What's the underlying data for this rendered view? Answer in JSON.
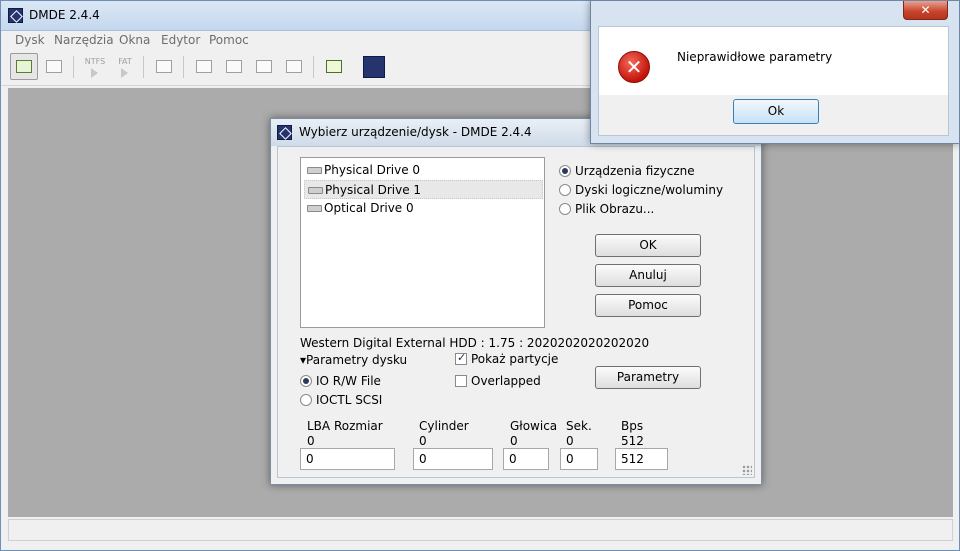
{
  "main_window": {
    "title": "DMDE 2.4.4",
    "menu": [
      "Dysk",
      "Narzędzia",
      "Okna",
      "Edytor",
      "Pomoc"
    ],
    "toolbar": {
      "ntfs_label": "NTFS",
      "fat_label": "FAT"
    }
  },
  "select_dialog": {
    "title": "Wybierz urządzenie/dysk - DMDE 2.4.4",
    "drives": [
      "Physical Drive 0",
      "Physical Drive 1",
      "Optical Drive 0"
    ],
    "selected_drive": "Physical Drive 1",
    "source_options": [
      "Urządzenia fizyczne",
      "Dyski logiczne/woluminy",
      "Plik Obrazu..."
    ],
    "selected_source": "Urządzenia fizyczne",
    "buttons": {
      "ok": "OK",
      "cancel": "Anuluj",
      "help": "Pomoc",
      "params": "Parametry"
    },
    "device_info": "Western Digital  External HDD    : 1.75 : 2020202020202020",
    "params_section": "Parametry dysku",
    "io_options": [
      "IO R/W File",
      "IOCTL SCSI"
    ],
    "selected_io": "IO R/W File",
    "checkboxes": {
      "show_partitions": {
        "label": "Pokaż partycje",
        "checked": true
      },
      "overlapped": {
        "label": "Overlapped",
        "checked": false
      }
    },
    "geometry": {
      "lba": {
        "label": "LBA Rozmiar",
        "current": "0",
        "value": "0"
      },
      "cylinder": {
        "label": "Cylinder",
        "current": "0",
        "value": "0"
      },
      "heads": {
        "label": "Głowica",
        "current": "0",
        "value": "0"
      },
      "sectors": {
        "label": "Sek.",
        "current": "0",
        "value": "0"
      },
      "bps": {
        "label": "Bps",
        "current": "512",
        "value": "512"
      }
    }
  },
  "error_dialog": {
    "message": "Nieprawidłowe parametry",
    "ok_label": "Ok",
    "close_label": "✕"
  }
}
